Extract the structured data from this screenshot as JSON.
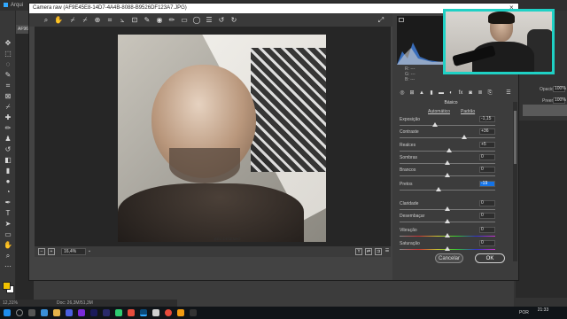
{
  "photoshop": {
    "menu": [
      "Arqui"
    ],
    "doc_tab": "AF96",
    "status_zoom": "12,31%",
    "status_doc": "Doc: 26,3M/51,3M",
    "right_panel": {
      "opacity_label": "Opacidade:",
      "opacity_value": "100%",
      "fill_label": "Preen.:",
      "fill_value": "100%"
    },
    "swatches": {
      "foreground": "#f2c200",
      "background": "#ffffff"
    }
  },
  "camera_raw": {
    "title": "Camera raw (AF9E45E8-14D7-4A4B-8088-B9526DF123A7.JPG)",
    "close_icon": "×",
    "zoom_value": "16,4%",
    "histogram_readout": {
      "r": "R:",
      "g": "G:",
      "b": "B:",
      "dashes": "---"
    },
    "panel_title": "Básico",
    "auto_link": "Automático",
    "default_link": "Padrão",
    "sliders": [
      {
        "label": "Exposição",
        "value": "-1,15",
        "position": 0.37
      },
      {
        "label": "Contraste",
        "value": "+36",
        "position": 0.68
      },
      {
        "label": "Realces",
        "value": "+5",
        "position": 0.52
      },
      {
        "label": "Sombras",
        "value": "0",
        "position": 0.5
      },
      {
        "label": "Brancos",
        "value": "0",
        "position": 0.5
      },
      {
        "label": "Pretos",
        "value": "-19",
        "position": 0.41
      },
      {
        "label": "Claridade",
        "value": "0",
        "position": 0.5
      },
      {
        "label": "Desembaçar",
        "value": "0",
        "position": 0.5
      },
      {
        "label": "Vibração",
        "value": "0",
        "position": 0.5
      },
      {
        "label": "Saturação",
        "value": "0",
        "position": 0.5
      }
    ],
    "cancel_label": "Cancelar",
    "ok_label": "OK",
    "artist_watermark": "@EU.DESENHO"
  },
  "taskbar": {
    "language": "POR",
    "time": "21:33",
    "date": "12/..."
  },
  "colors": {
    "accent_webcam": "#1fd1c5",
    "selected_value": "#1473e6"
  }
}
